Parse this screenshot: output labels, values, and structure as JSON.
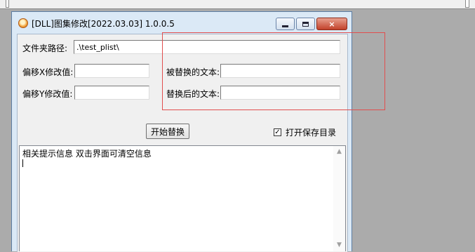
{
  "window": {
    "title": "[DLL]图集修改[2022.03.03] 1.0.0.5",
    "close_glyph": "×"
  },
  "form": {
    "folder_path_label": "文件夹路径:",
    "folder_path_value": ".\\test_plist\\",
    "offset_x_label": "偏移X修改值:",
    "offset_x_value": "",
    "offset_y_label": "偏移Y修改值:",
    "offset_y_value": "",
    "replaced_text_label": "被替换的文本:",
    "replaced_text_value": "",
    "replacement_text_label": "替换后的文本:",
    "replacement_text_value": "",
    "start_button": "开始替换",
    "open_save_dir_label": "打开保存目录",
    "open_save_dir_checked": true,
    "check_glyph": "✓"
  },
  "log": {
    "text": "相关提示信息 双击界面可清空信息"
  },
  "scrollbar": {
    "up_glyph": "▲",
    "down_glyph": "▼"
  },
  "colors": {
    "highlight_box": "#e14e4e",
    "frame": "#dbe9f6"
  }
}
